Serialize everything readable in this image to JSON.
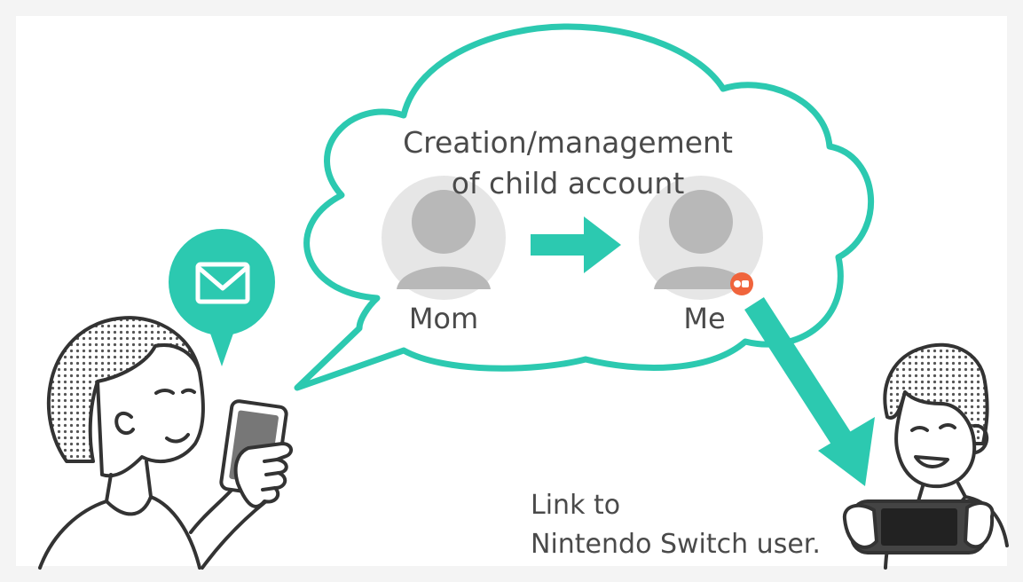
{
  "cloud": {
    "title": "Creation/management\nof child account"
  },
  "accounts": {
    "parent_label": "Mom",
    "child_label": "Me"
  },
  "caption": {
    "link_text": "Link to\nNintendo Switch user."
  },
  "colors": {
    "teal": "#2cc9b0",
    "avatar_bg": "#e6e6e6",
    "avatar_fg": "#b8b8b8",
    "badge": "#f0643c",
    "line_art": "#333333",
    "text": "#4a4a4a"
  },
  "icons": {
    "speech_bubble": "mail-icon",
    "parent_avatar": "user-avatar-icon",
    "child_avatar": "user-avatar-icon",
    "child_badge": "child-account-badge-icon",
    "transfer_arrow": "arrow-right-icon",
    "link_arrow": "arrow-down-right-icon"
  }
}
